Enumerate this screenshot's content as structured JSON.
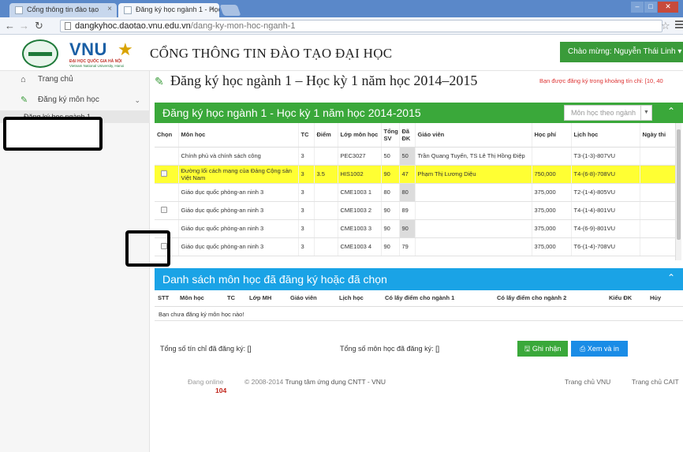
{
  "browser": {
    "tabs": [
      {
        "label": "Cổng thông tin đào tạo"
      },
      {
        "label": "Đăng ký học ngành 1 - Học k"
      }
    ],
    "url_host": "dangkyhoc.daotao.vnu.edu.vn",
    "url_path": "/dang-ky-mon-hoc-nganh-1"
  },
  "header": {
    "logo_text": "VNU",
    "logo_sub1": "ĐẠI HỌC QUỐC GIA HÀ NỘI",
    "logo_sub2": "Vietnam National University, Hanoi",
    "portal_title": "CỔNG THÔNG TIN ĐÀO TẠO ĐẠI HỌC",
    "welcome": "Chào mừng: Nguyễn Thái Linh ▾"
  },
  "sidebar": {
    "home": "Trang chủ",
    "register": "Đăng ký môn học",
    "sub": "Đăng ký học ngành 1"
  },
  "page": {
    "title": "Đăng ký học ngành 1 – Học kỳ 1 năm học 2014–2015",
    "notice": "Bạn được đăng ký trong khoảng tín chỉ: [10, 40"
  },
  "course_panel": {
    "title": "Đăng ký học ngành 1 - Học kỳ 1 năm học 2014-2015",
    "filter_placeholder": "Môn học theo ngành"
  },
  "course_table": {
    "headers": [
      "Chọn",
      "Môn học",
      "TC",
      "Điểm",
      "Lớp môn học",
      "Tổng SV",
      "Đã ĐK",
      "Giáo viên",
      "Học phí",
      "Lịch học",
      "Ngày thi"
    ],
    "rows": [
      {
        "check": false,
        "name": "Chính phủ và chính sách công",
        "tc": "3",
        "diem": "",
        "lop": "PEC3027",
        "tong": "50",
        "dk": "50",
        "gv": "Trần Quang Tuyến, TS Lê Thị Hồng Điệp",
        "hp": "",
        "lich": "T3-(1-3)-807VU",
        "thi": "",
        "full": true,
        "highlight": false
      },
      {
        "check": true,
        "name": "Đường lối cách mạng của Đảng Cộng sản Việt Nam",
        "tc": "3",
        "diem": "3.5",
        "lop": "HIS1002",
        "tong": "90",
        "dk": "47",
        "gv": "Phạm Thị Lương Diệu",
        "hp": "750,000",
        "lich": "T4-(6-8)-708VU",
        "thi": "",
        "full": false,
        "highlight": true
      },
      {
        "check": false,
        "name": "Giáo dục quốc phòng-an ninh 3",
        "tc": "3",
        "diem": "",
        "lop": "CME1003 1",
        "tong": "80",
        "dk": "80",
        "gv": "",
        "hp": "375,000",
        "lich": "T2-(1-4)-805VU",
        "thi": "",
        "full": true,
        "highlight": false
      },
      {
        "check": true,
        "name": "Giáo dục quốc phòng-an ninh 3",
        "tc": "3",
        "diem": "",
        "lop": "CME1003 2",
        "tong": "90",
        "dk": "89",
        "gv": "",
        "hp": "375,000",
        "lich": "T4-(1-4)-801VU",
        "thi": "",
        "full": false,
        "highlight": false
      },
      {
        "check": false,
        "name": "Giáo dục quốc phòng-an ninh 3",
        "tc": "3",
        "diem": "",
        "lop": "CME1003 3",
        "tong": "90",
        "dk": "90",
        "gv": "",
        "hp": "375,000",
        "lich": "T4-(6-9)-801VU",
        "thi": "",
        "full": true,
        "highlight": false
      },
      {
        "check": true,
        "name": "Giáo dục quốc phòng-an ninh 3",
        "tc": "3",
        "diem": "",
        "lop": "CME1003 4",
        "tong": "90",
        "dk": "79",
        "gv": "",
        "hp": "375,000",
        "lich": "T6-(1-4)-708VU",
        "thi": "",
        "full": false,
        "highlight": false
      }
    ]
  },
  "registered_panel": {
    "title": "Danh sách môn học đã đăng ký hoặc đã chọn",
    "headers": [
      "STT",
      "Môn học",
      "TC",
      "Lớp MH",
      "Giáo viên",
      "Lịch học",
      "Có lấy điểm cho ngành 1",
      "Có lấy điểm cho ngành 2",
      "Kiểu ĐK",
      "Hủy"
    ],
    "empty": "Bạn chưa đăng ký môn học nào!"
  },
  "totals": {
    "credits": "Tổng số tín chỉ đã đăng ký: []",
    "courses": "Tổng số môn học đã đăng ký: []",
    "save_btn": "Ghi nhận",
    "print_btn": "Xem và in"
  },
  "footer": {
    "online_label": "Đang online",
    "online_count": "104",
    "copyright": "© 2008-2014",
    "center": "Trung tâm ứng dụng CNTT - VNU",
    "link1": "Trang chủ VNU",
    "link2": "Trang chủ CAIT"
  },
  "colors": {
    "green": "#3aa83a",
    "blue": "#1aa3e6",
    "highlight": "#ffff33",
    "notice_red": "#dd3333"
  }
}
